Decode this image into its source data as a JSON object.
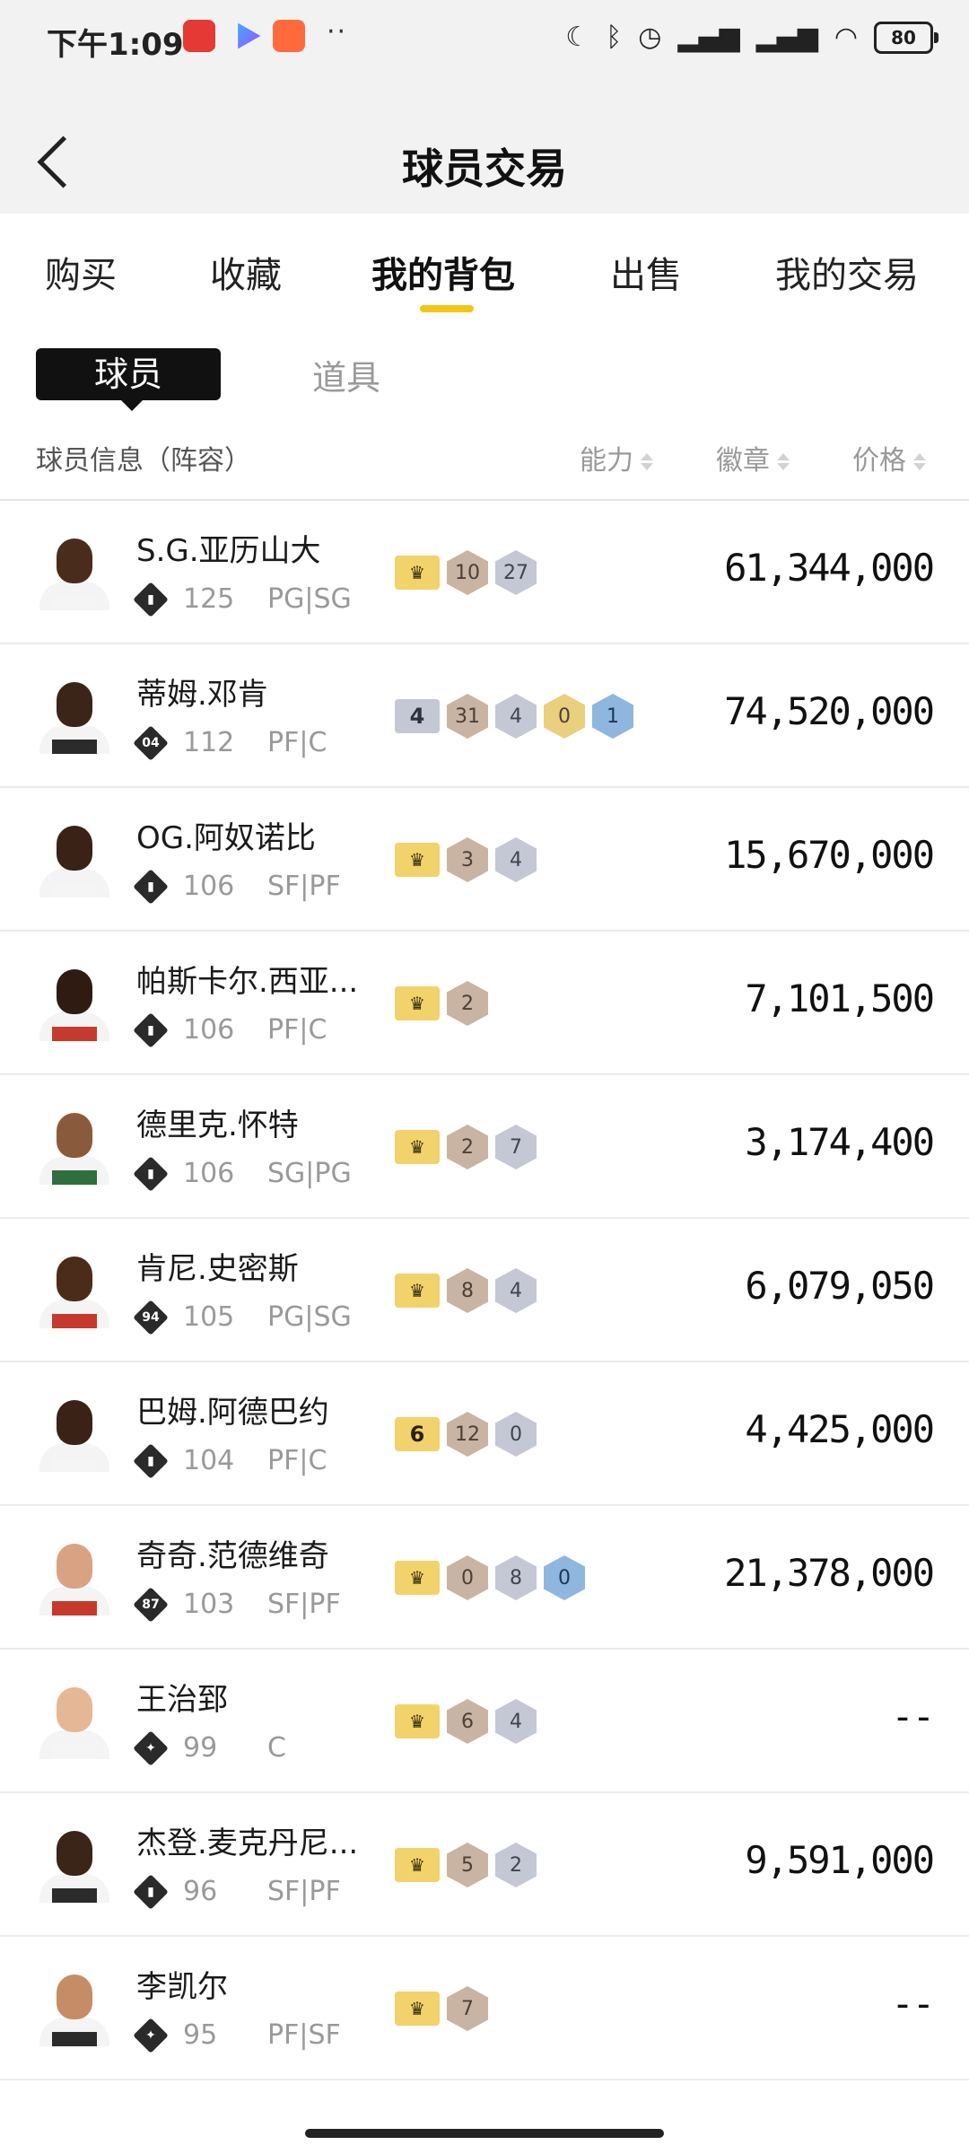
{
  "status_bar": {
    "time": "下午1:09",
    "dots": "··",
    "battery": "80"
  },
  "header": {
    "title": "球员交易"
  },
  "tabs": [
    {
      "label": "购买",
      "active": false
    },
    {
      "label": "收藏",
      "active": false
    },
    {
      "label": "我的背包",
      "active": true
    },
    {
      "label": "出售",
      "active": false
    },
    {
      "label": "我的交易",
      "active": false
    }
  ],
  "subtabs": {
    "active": "球员",
    "inactive": "道具"
  },
  "columns": {
    "info": "球员信息（阵容）",
    "ability": "能力",
    "badge": "徽章",
    "price": "价格"
  },
  "colors": {
    "accent": "#f3c614",
    "crown_badge": "#f2d26a",
    "bronze": "#c9b3a2",
    "silver": "#c3c8d4",
    "gold": "#e9cf7e",
    "blue": "#8fb6de"
  },
  "players": [
    {
      "name": "S.G.亚历山大",
      "rank_icon": "bars-icon",
      "ability": "125",
      "pos": "PG|SG",
      "tag": {
        "type": "crown"
      },
      "badges": [
        {
          "t": "bronze",
          "v": "10"
        },
        {
          "t": "silver",
          "v": "27"
        }
      ],
      "price": "61,344,000",
      "skin": "#4a2c1d",
      "jersey": "#f5f5f5"
    },
    {
      "name": "蒂姆.邓肯",
      "rank_icon": "04",
      "ability": "112",
      "pos": "PF|C",
      "tag": {
        "type": "gray",
        "v": "4"
      },
      "badges": [
        {
          "t": "bronze",
          "v": "31"
        },
        {
          "t": "silver",
          "v": "4"
        },
        {
          "t": "gold",
          "v": "0"
        },
        {
          "t": "blue",
          "v": "1"
        }
      ],
      "price": "74,520,000",
      "skin": "#3b2418",
      "jersey": "#2b2b2b"
    },
    {
      "name": "OG.阿奴诺比",
      "rank_icon": "bars-icon",
      "ability": "106",
      "pos": "SF|PF",
      "tag": {
        "type": "crown"
      },
      "badges": [
        {
          "t": "bronze",
          "v": "3"
        },
        {
          "t": "silver",
          "v": "4"
        }
      ],
      "price": "15,670,000",
      "skin": "#3a2216",
      "jersey": "#f5f5f5"
    },
    {
      "name": "帕斯卡尔.西亚...",
      "rank_icon": "bars-icon",
      "ability": "106",
      "pos": "PF|C",
      "tag": {
        "type": "crown"
      },
      "badges": [
        {
          "t": "bronze",
          "v": "2"
        }
      ],
      "price": "7,101,500",
      "skin": "#2f1b12",
      "jersey": "#c53a2c"
    },
    {
      "name": "德里克.怀特",
      "rank_icon": "bars-icon",
      "ability": "106",
      "pos": "SG|PG",
      "tag": {
        "type": "crown"
      },
      "badges": [
        {
          "t": "bronze",
          "v": "2"
        },
        {
          "t": "silver",
          "v": "7"
        }
      ],
      "price": "3,174,400",
      "skin": "#8a5a3c",
      "jersey": "#2f6e3d"
    },
    {
      "name": "肯尼.史密斯",
      "rank_icon": "94",
      "ability": "105",
      "pos": "PG|SG",
      "tag": {
        "type": "crown"
      },
      "badges": [
        {
          "t": "bronze",
          "v": "8"
        },
        {
          "t": "silver",
          "v": "4"
        }
      ],
      "price": "6,079,050",
      "skin": "#4b2c1b",
      "jersey": "#c53a2c"
    },
    {
      "name": "巴姆.阿德巴约",
      "rank_icon": "bars-icon",
      "ability": "104",
      "pos": "PF|C",
      "tag": {
        "type": "yellow",
        "v": "6"
      },
      "badges": [
        {
          "t": "bronze",
          "v": "12"
        },
        {
          "t": "silver",
          "v": "0"
        }
      ],
      "price": "4,425,000",
      "skin": "#3a2216",
      "jersey": "#f5f5f5"
    },
    {
      "name": "奇奇.范德维奇",
      "rank_icon": "87",
      "ability": "103",
      "pos": "SF|PF",
      "tag": {
        "type": "crown"
      },
      "badges": [
        {
          "t": "bronze",
          "v": "0"
        },
        {
          "t": "silver",
          "v": "8"
        },
        {
          "t": "blue",
          "v": "0"
        }
      ],
      "price": "21,378,000",
      "skin": "#d9a383",
      "jersey": "#c53a2c"
    },
    {
      "name": "王治郅",
      "rank_icon": "star-icon",
      "ability": "99",
      "pos": "C",
      "tag": {
        "type": "crown"
      },
      "badges": [
        {
          "t": "bronze",
          "v": "6"
        },
        {
          "t": "silver",
          "v": "4"
        }
      ],
      "price": "--",
      "skin": "#e6b796",
      "jersey": "#f5f5f5"
    },
    {
      "name": "杰登.麦克丹尼...",
      "rank_icon": "bars-icon",
      "ability": "96",
      "pos": "SF|PF",
      "tag": {
        "type": "crown"
      },
      "badges": [
        {
          "t": "bronze",
          "v": "5"
        },
        {
          "t": "silver",
          "v": "2"
        }
      ],
      "price": "9,591,000",
      "skin": "#3b2418",
      "jersey": "#2b2b2b"
    },
    {
      "name": "李凯尔",
      "rank_icon": "star-icon",
      "ability": "95",
      "pos": "PF|SF",
      "tag": {
        "type": "crown"
      },
      "badges": [
        {
          "t": "bronze",
          "v": "7"
        }
      ],
      "price": "--",
      "skin": "#c68c66",
      "jersey": "#2b2b2b"
    }
  ]
}
